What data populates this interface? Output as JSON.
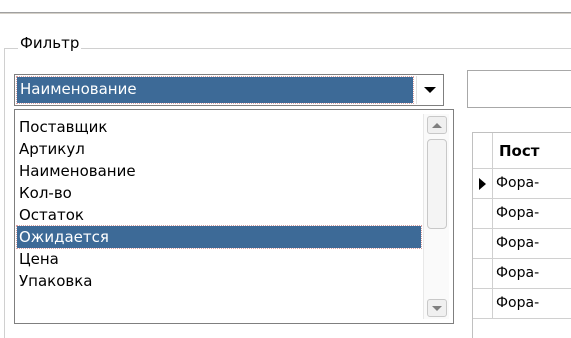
{
  "filter": {
    "group_label": "Фильтр",
    "selected_field": "Наименование",
    "search_value": ""
  },
  "dropdown": {
    "options": [
      {
        "label": "Поставщик",
        "selected": false
      },
      {
        "label": "Артикул",
        "selected": false
      },
      {
        "label": "Наименование",
        "selected": false
      },
      {
        "label": "Кол-во",
        "selected": false
      },
      {
        "label": "Остаток",
        "selected": false
      },
      {
        "label": "Ожидается",
        "selected": true
      },
      {
        "label": "Цена",
        "selected": false
      },
      {
        "label": "Упаковка",
        "selected": false
      }
    ]
  },
  "grid": {
    "columns": [
      "Пост"
    ],
    "rows": [
      {
        "cell": "Фора-",
        "current": true
      },
      {
        "cell": "Фора-",
        "current": false
      },
      {
        "cell": "Фора-",
        "current": false
      },
      {
        "cell": "Фора-",
        "current": false
      },
      {
        "cell": "Фора-",
        "current": false
      }
    ]
  },
  "colors": {
    "selection": "#3d6a97",
    "selection_text": "#ffffff"
  }
}
